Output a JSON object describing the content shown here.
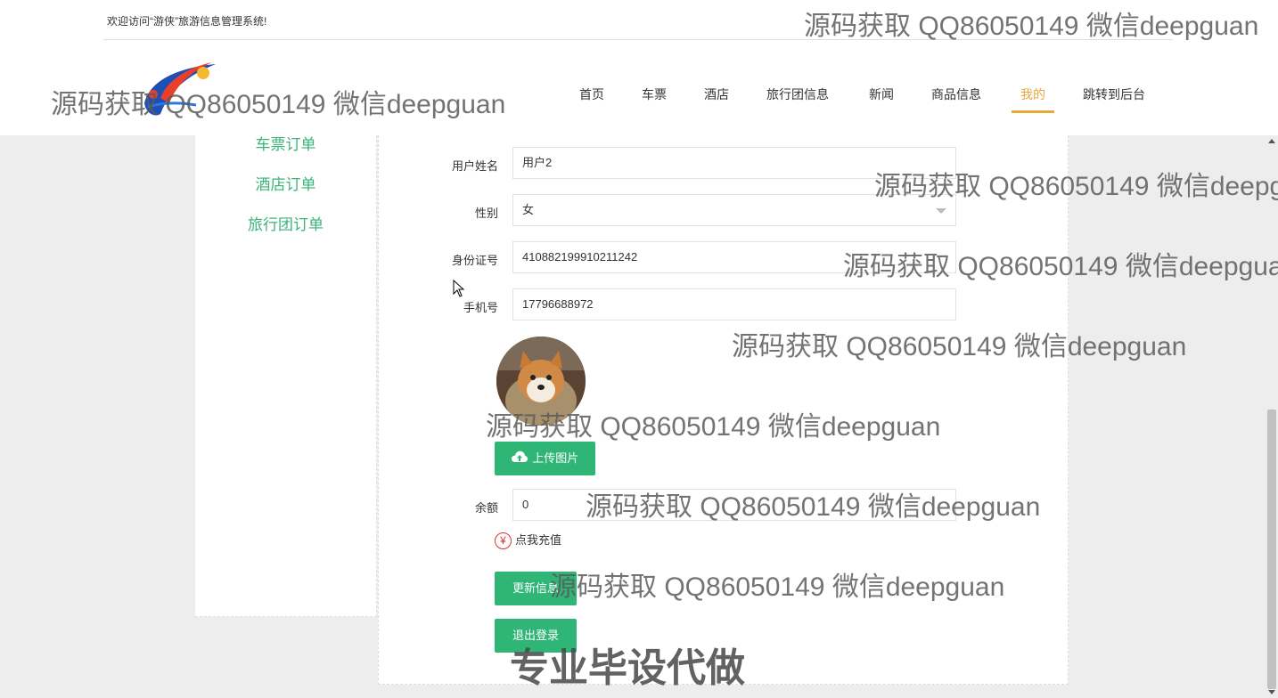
{
  "header": {
    "welcome": "欢迎访问“游侠”旅游信息管理系统!",
    "nav": [
      {
        "label": "首页",
        "active": false
      },
      {
        "label": "车票",
        "active": false
      },
      {
        "label": "酒店",
        "active": false
      },
      {
        "label": "旅行团信息",
        "active": false
      },
      {
        "label": "新闻",
        "active": false
      },
      {
        "label": "商品信息",
        "active": false
      },
      {
        "label": "我的",
        "active": true
      },
      {
        "label": "跳转到后台",
        "active": false
      }
    ]
  },
  "sidebar": {
    "items": [
      {
        "label": "车票订单"
      },
      {
        "label": "酒店订单"
      },
      {
        "label": "旅行团订单"
      }
    ]
  },
  "form": {
    "name_label": "用户姓名",
    "name_value": "用户2",
    "gender_label": "性别",
    "gender_value": "女",
    "id_label": "身份证号",
    "id_value": "410882199910211242",
    "phone_label": "手机号",
    "phone_value": "17796688972",
    "upload_label": "上传图片",
    "balance_label": "余额",
    "balance_value": "0",
    "recharge_label": "点我充值",
    "recharge_icon": "¥",
    "update_label": "更新信息",
    "logout_label": "退出登录"
  },
  "watermarks": {
    "text": "源码获取 QQ86050149 微信deepguan",
    "big_text": "专业毕设代做"
  },
  "colors": {
    "accent_green": "#2fb677",
    "link_green": "#3bb37a",
    "active_nav": "#e7a93b",
    "recharge_red": "#e03030"
  }
}
